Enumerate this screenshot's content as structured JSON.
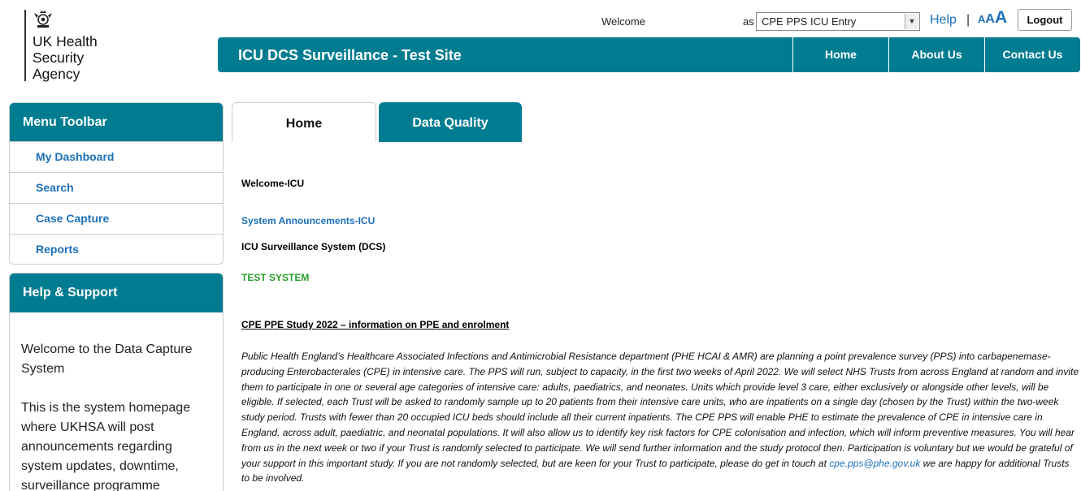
{
  "logo": {
    "text": "UK Health Security Agency",
    "icon": "royal-crest-icon"
  },
  "header": {
    "welcome": "Welcome",
    "as_label": "as",
    "role_value": "CPE PPS ICU Entry",
    "help": "Help",
    "separator": "|",
    "font_small": "A",
    "font_medium": "A",
    "font_large": "A",
    "logout": "Logout"
  },
  "topbar": {
    "title": "ICU DCS Surveillance - Test Site",
    "nav": [
      "Home",
      "About Us",
      "Contact Us"
    ]
  },
  "sidebar": {
    "menu_title": "Menu Toolbar",
    "items": [
      "My Dashboard",
      "Search",
      "Case Capture",
      "Reports"
    ],
    "help_title": "Help & Support",
    "help_p1": "Welcome to the Data Capture System",
    "help_p2": "This is the system homepage where UKHSA will post announcements regarding system updates, downtime, surveillance programme"
  },
  "tabs": {
    "home": "Home",
    "data_quality": "Data Quality"
  },
  "main": {
    "welcome_heading": "Welcome-ICU",
    "announcements": "System Announcements-ICU",
    "system_name": "ICU Surveillance System (DCS)",
    "test_system": "TEST SYSTEM",
    "study_title": "CPE PPE Study 2022 – information on PPE and enrolment",
    "body": "Public Health England’s Healthcare Associated Infections and Antimicrobial Resistance department (PHE HCAI & AMR) are planning a point prevalence survey (PPS) into carbapenemase-producing Enterobacterales (CPE) in intensive care. The PPS will run, subject to capacity, in the first two weeks of April 2022. We will select NHS Trusts from across England at random and invite them to participate in one or several age categories of intensive care: adults, paediatrics, and neonates. Units which provide level 3 care, either exclusively or alongside other levels, will be eligible. If selected, each Trust will be asked to randomly sample up to 20 patients from their intensive care units, who are inpatients on a single day (chosen by the Trust) within the two-week study period. Trusts with fewer than 20 occupied ICU beds should include all their current inpatients. The CPE PPS will enable PHE to estimate the prevalence of CPE in intensive care in England, across adult, paediatric, and neonatal populations. It will also allow us to identify key risk factors for CPE colonisation and infection, which will inform preventive measures. You will hear from us in the next week or two if your Trust is randomly selected to participate. We will send further information and the study protocol then. Participation is voluntary but we would be grateful of your support in this important study. If you are not randomly selected, but are keen for your Trust to participate, please do get in touch at",
    "email": "cpe.pps@phe.gov.uk",
    "body_end": "we are happy for additional Trusts to be involved."
  },
  "colors": {
    "brand": "#007c91",
    "link": "#1d70b8",
    "test_green": "#2a9d2a"
  }
}
